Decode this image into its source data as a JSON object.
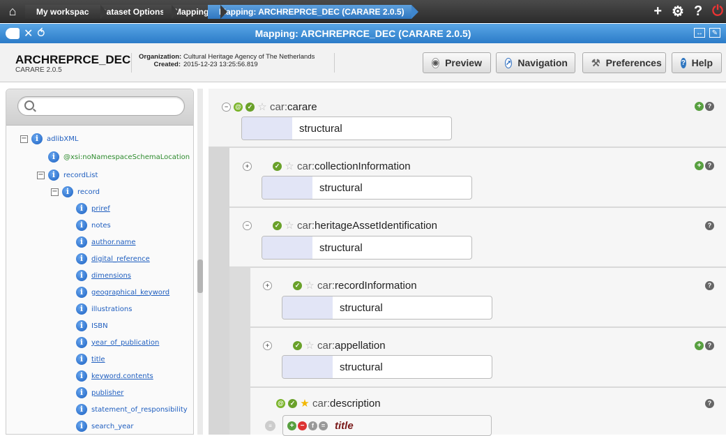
{
  "breadcrumbs": [
    "My workspace",
    "Dataset Options",
    "Mappings",
    "Mapping: ARCHREPRCE_DEC (CARARE 2.0.5)"
  ],
  "titlebar": {
    "title": "Mapping: ARCHREPRCE_DEC (CARARE 2.0.5)"
  },
  "header": {
    "mapping_name": "ARCHREPRCE_DEC",
    "schema": "CARARE 2.0.5",
    "org_label": "Organization:",
    "org_value": "Cultural Heritage Agency of The Netherlands",
    "created_label": "Created:",
    "created_value": "2015-12-23 13:25:56.819",
    "buttons": {
      "preview": "Preview",
      "navigation": "Navigation",
      "preferences": "Preferences",
      "help": "Help"
    }
  },
  "tree": {
    "search_placeholder": "",
    "nodes": [
      {
        "label": "adlibXML"
      },
      {
        "label": "@xsi:noNamespaceSchemaLocation"
      },
      {
        "label": "recordList"
      },
      {
        "label": "record"
      },
      {
        "label": "priref"
      },
      {
        "label": "notes"
      },
      {
        "label": "author.name"
      },
      {
        "label": "digital_reference"
      },
      {
        "label": "dimensions"
      },
      {
        "label": "geographical_keyword"
      },
      {
        "label": "illustrations"
      },
      {
        "label": "ISBN"
      },
      {
        "label": "year_of_publication"
      },
      {
        "label": "title"
      },
      {
        "label": "keyword.contents"
      },
      {
        "label": "publisher"
      },
      {
        "label": "statement_of_responsibility"
      },
      {
        "label": "search_year"
      }
    ]
  },
  "mapping": {
    "prefix": "car:",
    "struct_label": "structural",
    "elements": [
      {
        "name": "carare"
      },
      {
        "name": "collectionInformation"
      },
      {
        "name": "heritageAssetIdentification"
      },
      {
        "name": "recordInformation"
      },
      {
        "name": "appellation"
      },
      {
        "name": "description"
      }
    ],
    "description_value": "title"
  }
}
